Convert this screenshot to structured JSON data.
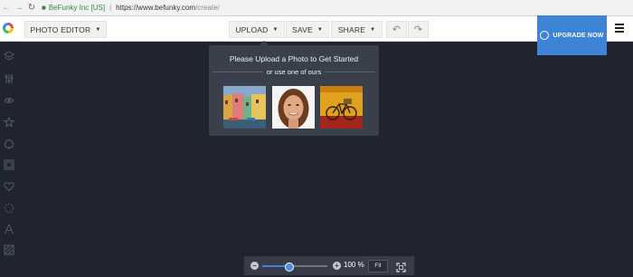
{
  "browser": {
    "back": "←",
    "forward": "→",
    "reload": "↻",
    "site_name": "BeFunky Inc [US]",
    "url_host": "https://www.befunky.com",
    "url_path": "/create/"
  },
  "header": {
    "mode_label": "PHOTO EDITOR",
    "upload_label": "UPLOAD",
    "save_label": "SAVE",
    "share_label": "SHARE",
    "undo_symbol": "↶",
    "redo_symbol": "↷",
    "upgrade_label": "UPGRADE NOW",
    "accent_color": "#3e84d6"
  },
  "tools": [
    {
      "name": "layers-icon"
    },
    {
      "name": "adjust-sliders-icon"
    },
    {
      "name": "eye-icon"
    },
    {
      "name": "star-icon"
    },
    {
      "name": "badge-icon"
    },
    {
      "name": "frame-icon"
    },
    {
      "name": "heart-icon"
    },
    {
      "name": "textures-icon"
    },
    {
      "name": "text-icon"
    },
    {
      "name": "pattern-icon"
    }
  ],
  "popover": {
    "title": "Please Upload a Photo to Get Started",
    "subtitle": "or use one of ours",
    "samples": [
      "sample-houses",
      "sample-portrait",
      "sample-bicycle"
    ]
  },
  "zoom": {
    "minus": "−",
    "plus": "+",
    "level_fraction": 0.42,
    "percent": "100 %",
    "fit_label": "Fit"
  }
}
